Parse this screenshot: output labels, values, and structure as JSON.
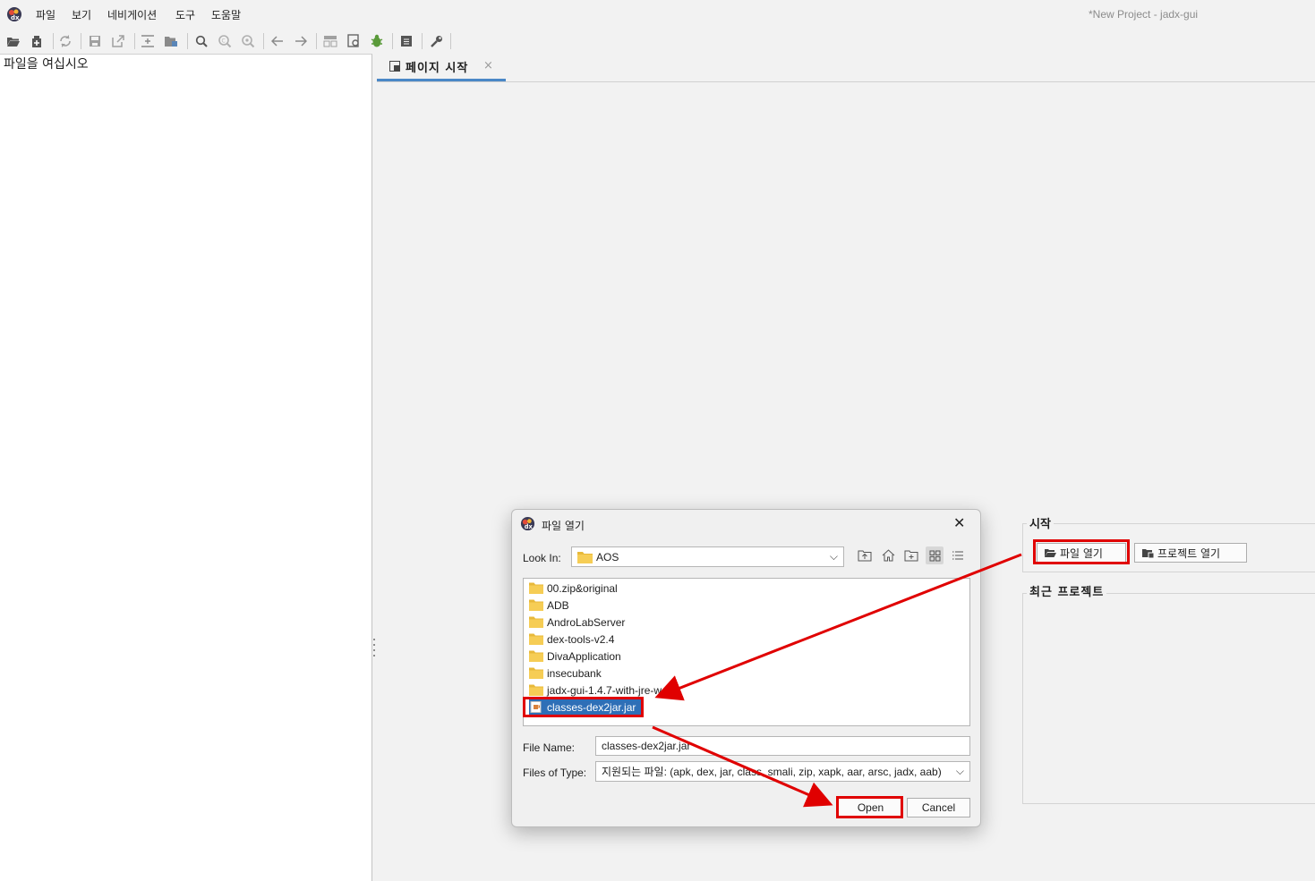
{
  "window": {
    "title": "*New Project - jadx-gui"
  },
  "menu": [
    "파일",
    "보기",
    "네비게이션",
    "도구",
    "도움말"
  ],
  "toolbar": {
    "icons": [
      "folder-open-icon",
      "add-files-icon",
      "sync-icon",
      "save-all-icon",
      "export-icon",
      "sync-tree-icon",
      "flatten-packages-icon",
      "search-icon",
      "find-class-icon",
      "find-usage-icon",
      "back-icon",
      "forward-icon",
      "deobfuscation-icon",
      "quark-icon",
      "debugger-icon",
      "log-viewer-icon",
      "preferences-icon"
    ]
  },
  "left_panel": {
    "hint": "파일을 여십시오"
  },
  "tab": {
    "label": "페이지 시작",
    "close": "×"
  },
  "start_page": {
    "start_title": "시작",
    "open_file_label": "파일 열기",
    "open_project_label": "프로젝트 열기",
    "recent_title": "최근 프로젝트"
  },
  "dialog": {
    "title": "파일 열기",
    "close": "✕",
    "look_in_label": "Look In:",
    "look_in_value": "AOS",
    "nav_icons": [
      "up-folder-icon",
      "home-icon",
      "new-folder-icon",
      "list-view-icon",
      "details-view-icon"
    ],
    "items": [
      {
        "name": "00.zip&original",
        "type": "folder"
      },
      {
        "name": "ADB",
        "type": "folder"
      },
      {
        "name": "AndroLabServer",
        "type": "folder"
      },
      {
        "name": "dex-tools-v2.4",
        "type": "folder"
      },
      {
        "name": "DivaApplication",
        "type": "folder"
      },
      {
        "name": "insecubank",
        "type": "folder"
      },
      {
        "name": "jadx-gui-1.4.7-with-jre-w",
        "type": "folder"
      },
      {
        "name": "classes-dex2jar.jar",
        "type": "jar",
        "selected": true
      }
    ],
    "file_name_label": "File Name:",
    "file_name_value": "classes-dex2jar.jar",
    "file_type_label": "Files of Type:",
    "file_type_value": "지원되는 파일: (apk, dex, jar, class, smali, zip, xapk, aar, arsc, jadx, aab)",
    "open_label": "Open",
    "cancel_label": "Cancel"
  },
  "colors": {
    "highlight": "#e00000",
    "selection": "#2e6fb7",
    "tab_accent": "#4a88c7"
  }
}
